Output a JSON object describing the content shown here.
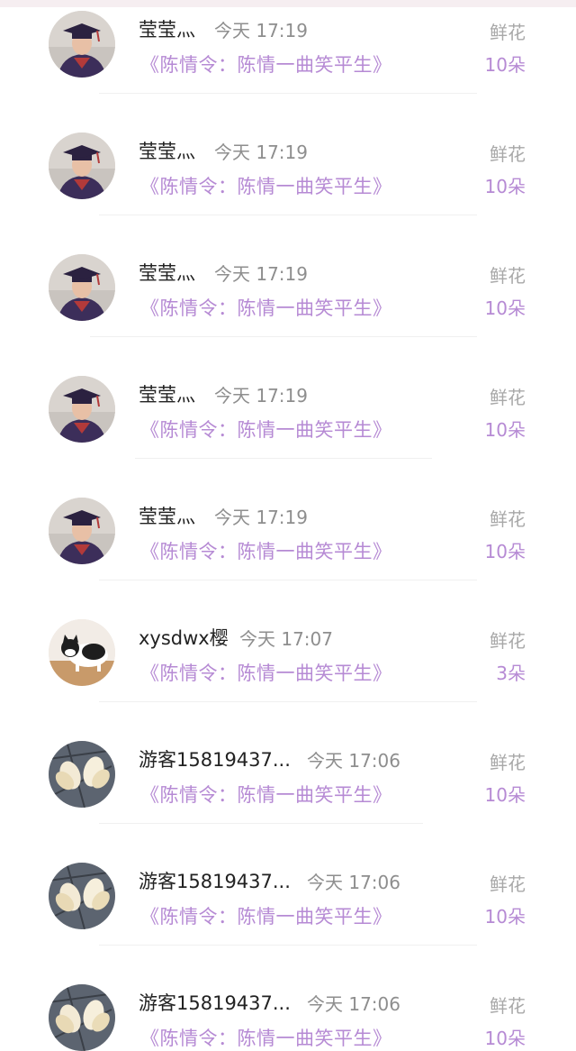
{
  "records": [
    {
      "name": "莹莹灬",
      "time": "今天 17:19",
      "title": "《陈情令：陈情一曲笑平生》",
      "gift_label": "鲜花",
      "gift_count": "10朵",
      "avatar": "graduate-avatar"
    },
    {
      "name": "莹莹灬",
      "time": "今天 17:19",
      "title": "《陈情令：陈情一曲笑平生》",
      "gift_label": "鲜花",
      "gift_count": "10朵",
      "avatar": "graduate-avatar"
    },
    {
      "name": "莹莹灬",
      "time": "今天 17:19",
      "title": "《陈情令：陈情一曲笑平生》",
      "gift_label": "鲜花",
      "gift_count": "10朵",
      "avatar": "graduate-avatar"
    },
    {
      "name": "莹莹灬",
      "time": "今天 17:19",
      "title": "《陈情令：陈情一曲笑平生》",
      "gift_label": "鲜花",
      "gift_count": "10朵",
      "avatar": "graduate-avatar"
    },
    {
      "name": "莹莹灬",
      "time": "今天 17:19",
      "title": "《陈情令：陈情一曲笑平生》",
      "gift_label": "鲜花",
      "gift_count": "10朵",
      "avatar": "graduate-avatar"
    },
    {
      "name": "xysdwx樱",
      "time": "今天 17:07",
      "title": "《陈情令：陈情一曲笑平生》",
      "gift_label": "鲜花",
      "gift_count": "3朵",
      "avatar": "cat-avatar"
    },
    {
      "name": "游客15819437...",
      "time": "今天 17:06",
      "title": "《陈情令：陈情一曲笑平生》",
      "gift_label": "鲜花",
      "gift_count": "10朵",
      "avatar": "magnolia-avatar"
    },
    {
      "name": "游客15819437...",
      "time": "今天 17:06",
      "title": "《陈情令：陈情一曲笑平生》",
      "gift_label": "鲜花",
      "gift_count": "10朵",
      "avatar": "magnolia-avatar"
    },
    {
      "name": "游客15819437...",
      "time": "今天 17:06",
      "title": "《陈情令：陈情一曲笑平生》",
      "gift_label": "鲜花",
      "gift_count": "10朵",
      "avatar": "magnolia-avatar"
    }
  ],
  "colors": {
    "accent": "#b68ad4",
    "name": "#222222",
    "muted": "#8e8e8e",
    "gift_label": "#a8a8a8"
  }
}
